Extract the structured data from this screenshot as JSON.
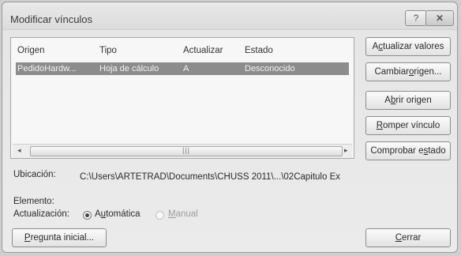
{
  "window": {
    "title": "Modificar vínculos",
    "help_label": "?",
    "close_label": "✕"
  },
  "table": {
    "columns": [
      "Origen",
      "Tipo",
      "Actualizar",
      "Estado"
    ],
    "rows": [
      [
        "PedidoHardw...",
        "Hoja de cálculo",
        "A",
        "Desconocido"
      ]
    ]
  },
  "buttons": {
    "update_values": {
      "pre": "A",
      "mn": "c",
      "post": "tualizar valores"
    },
    "change_source": {
      "pre": "Cambiar ",
      "mn": "o",
      "post": "rigen..."
    },
    "open_source": {
      "pre": "A",
      "mn": "b",
      "post": "rir origen"
    },
    "break_link": {
      "pre": "",
      "mn": "R",
      "post": "omper vínculo"
    },
    "check_status": {
      "pre": "Comprobar e",
      "mn": "s",
      "post": "tado"
    },
    "startup_prompt": {
      "pre": "",
      "mn": "P",
      "post": "regunta inicial..."
    },
    "close": {
      "pre": "",
      "mn": "C",
      "post": "errar"
    }
  },
  "details": {
    "location_label": "Ubicación:",
    "location_value": "C:\\Users\\ARTETRAD\\Documents\\CHUSS 2011\\...\\02Capitulo Ex",
    "element_label": "Elemento:",
    "update_label": "Actualización:",
    "auto": {
      "pre": "A",
      "mn": "u",
      "post": "tomática"
    },
    "manual": {
      "pre": "",
      "mn": "M",
      "post": "anual"
    }
  },
  "update_mode": "auto",
  "scroll": {
    "left_arrow": "◂",
    "right_arrow": "▸",
    "grip": "|||"
  }
}
